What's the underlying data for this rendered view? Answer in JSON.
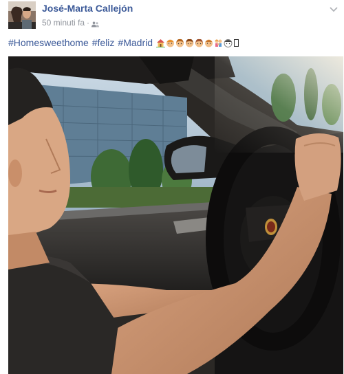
{
  "post": {
    "author": "José-Marta Callejón",
    "timestamp": "50 minuti fa",
    "separator": "·",
    "audience_icon": "friends-icon",
    "menu_icon": "chevron-down-icon"
  },
  "caption": {
    "hashtags": [
      "#Homesweethome",
      "#feliz",
      "#Madrid"
    ],
    "emoji_icons": [
      "house-icon",
      "face-icon",
      "face-icon",
      "face-icon",
      "face-icon",
      "face-icon",
      "family-icon",
      "face-icon",
      "unknown-glyph-icon"
    ]
  },
  "colors": {
    "link": "#3b5998",
    "muted": "#90949c"
  }
}
